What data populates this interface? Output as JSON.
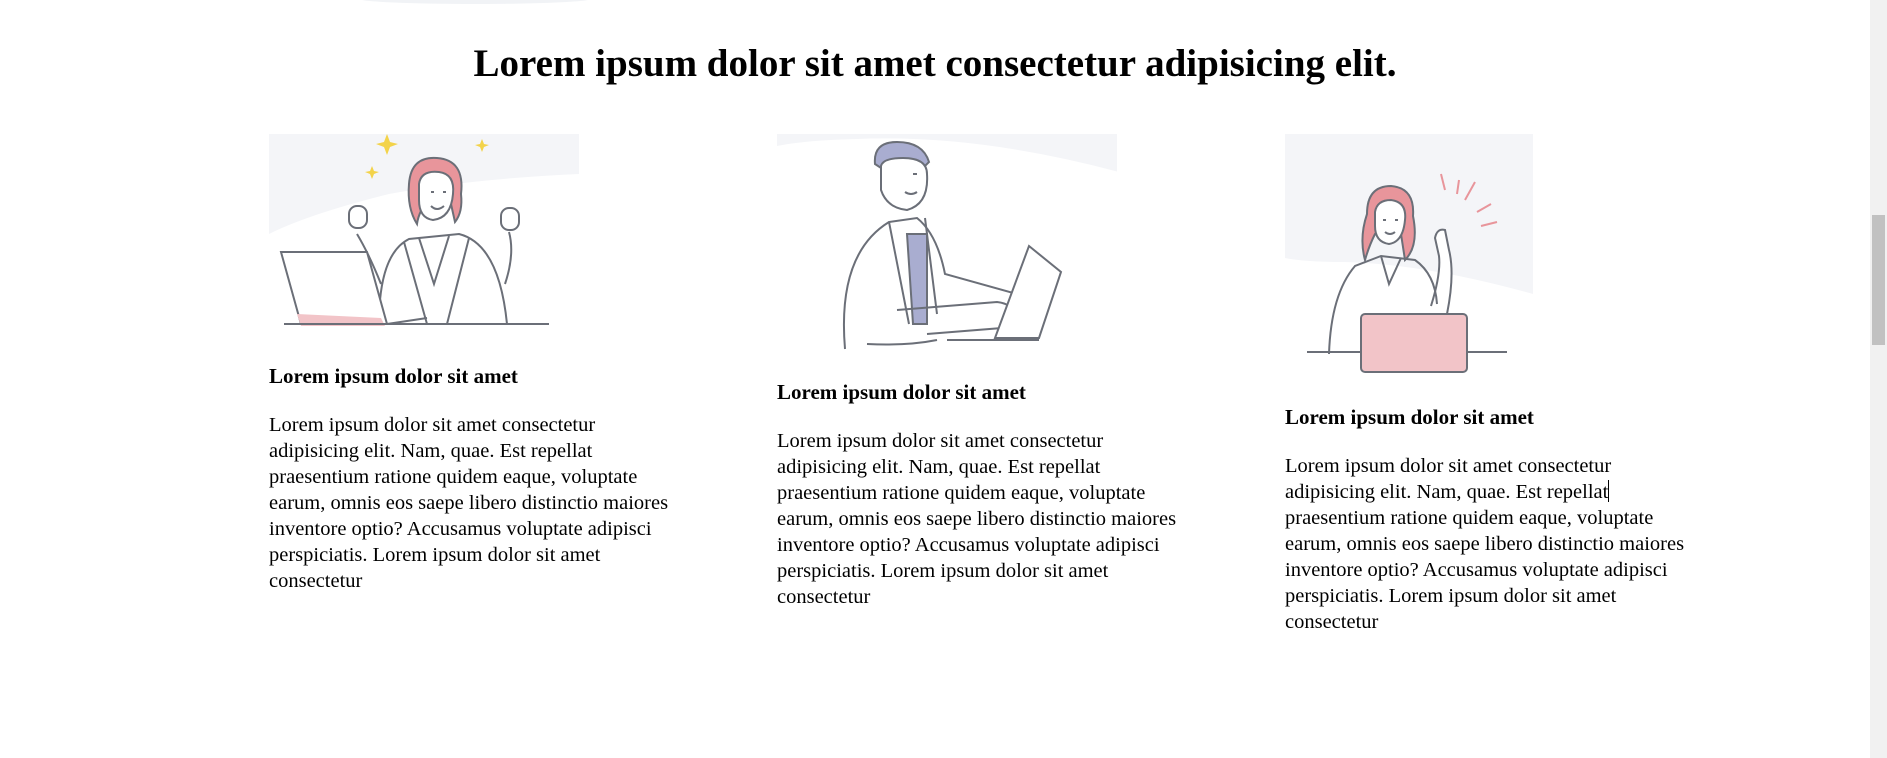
{
  "page": {
    "heading": "Lorem ipsum dolor sit amet consectetur adipisicing elit."
  },
  "cards": [
    {
      "title": "Lorem ipsum dolor sit amet",
      "body": "Lorem ipsum dolor sit amet consectetur adipisicing elit. Nam, quae. Est repellat praesentium ratione quidem eaque, voluptate earum, omnis eos saepe libero distinctio maiores inventore optio? Accusamus voluptate adipisci perspiciatis. Lorem ipsum dolor sit amet consectetur",
      "illustration": "celebrating-woman-laptop"
    },
    {
      "title": "Lorem ipsum dolor sit amet",
      "body": "Lorem ipsum dolor sit amet consectetur adipisicing elit. Nam, quae. Est repellat praesentium ratione quidem eaque, voluptate earum, omnis eos saepe libero distinctio maiores inventore optio? Accusamus voluptate adipisci perspiciatis. Lorem ipsum dolor sit amet consectetur",
      "illustration": "man-typing-laptop"
    },
    {
      "title": "Lorem ipsum dolor sit amet",
      "body_before_caret": "Lorem ipsum dolor sit amet consectetur adipisicing elit. Nam, quae. Est repellat",
      "body_after_caret": " praesentium ratione quidem eaque, voluptate earum, omnis eos saepe libero distinctio maiores inventore optio? Accusamus voluptate adipisci perspiciatis. Lorem ipsum dolor sit amet consectetur",
      "illustration": "woman-idea-laptop"
    }
  ],
  "colors": {
    "accent_pink": "#f2c4c8",
    "hair_pink": "#e8959b",
    "hair_lavender": "#a9add0",
    "star_yellow": "#f3d34a",
    "line_gray": "#6b6f78",
    "bg_tint": "#f4f5f8"
  }
}
